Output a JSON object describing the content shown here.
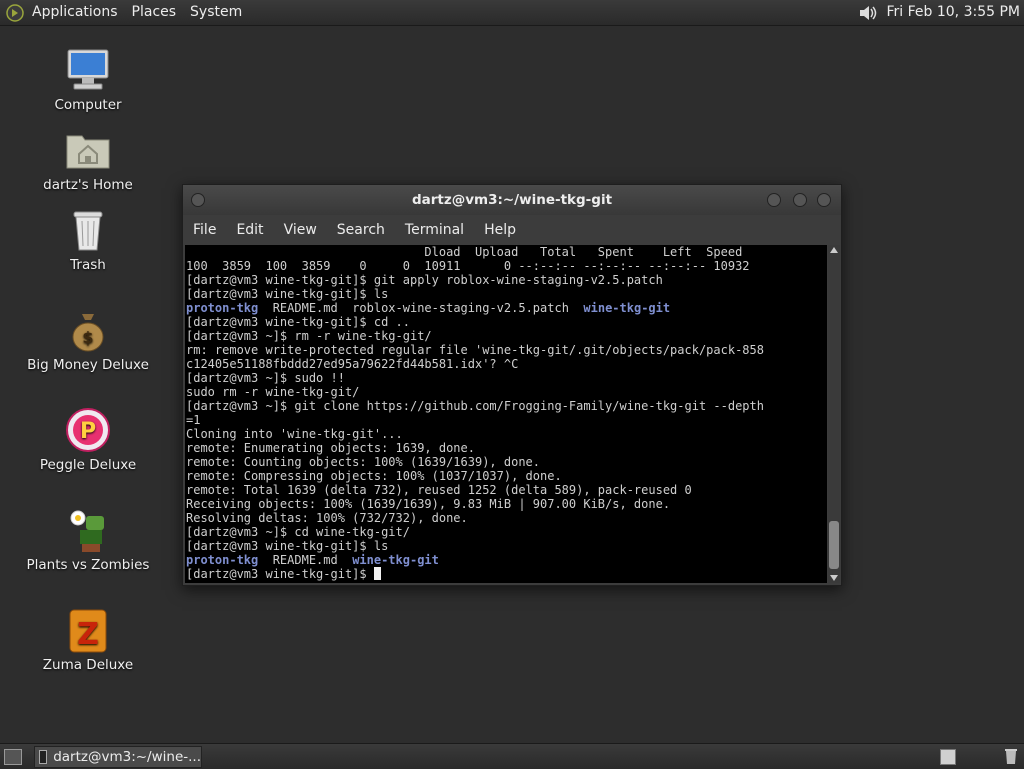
{
  "top_panel": {
    "menus": [
      "Applications",
      "Places",
      "System"
    ],
    "clock": "Fri Feb 10,  3:55 PM"
  },
  "desktop_icons": [
    {
      "label": "Computer",
      "icon": "computer-icon"
    },
    {
      "label": "dartz's Home",
      "icon": "home-folder-icon"
    },
    {
      "label": "Trash",
      "icon": "trash-icon"
    },
    {
      "label": "Big Money Deluxe",
      "icon": "money-bag-icon"
    },
    {
      "label": "Peggle Deluxe",
      "icon": "peggle-icon"
    },
    {
      "label": "Plants vs Zombies",
      "icon": "plants-vs-zombies-icon"
    },
    {
      "label": "Zuma Deluxe",
      "icon": "zuma-icon"
    }
  ],
  "terminal": {
    "title": "dartz@vm3:~/wine-tkg-git",
    "menu": [
      "File",
      "Edit",
      "View",
      "Search",
      "Terminal",
      "Help"
    ],
    "lines": [
      "                                 Dload  Upload   Total   Spent    Left  Speed",
      "100  3859  100  3859    0     0  10911      0 --:--:-- --:--:-- --:--:-- 10932",
      "[dartz@vm3 wine-tkg-git]$ git apply roblox-wine-staging-v2.5.patch",
      "[dartz@vm3 wine-tkg-git]$ ls",
      "[dartz@vm3 wine-tkg-git]$ cd ..",
      "[dartz@vm3 ~]$ rm -r wine-tkg-git/",
      "rm: remove write-protected regular file 'wine-tkg-git/.git/objects/pack/pack-858",
      "c12405e51188fbddd27ed95a79622fd44b581.idx'? ^C",
      "[dartz@vm3 ~]$ sudo !!",
      "sudo rm -r wine-tkg-git/",
      "[dartz@vm3 ~]$ git clone https://github.com/Frogging-Family/wine-tkg-git --depth",
      "=1",
      "Cloning into 'wine-tkg-git'...",
      "remote: Enumerating objects: 1639, done.",
      "remote: Counting objects: 100% (1639/1639), done.",
      "remote: Compressing objects: 100% (1037/1037), done.",
      "remote: Total 1639 (delta 732), reused 1252 (delta 589), pack-reused 0",
      "Receiving objects: 100% (1639/1639), 9.83 MiB | 907.00 KiB/s, done.",
      "Resolving deltas: 100% (732/732), done.",
      "[dartz@vm3 ~]$ cd wine-tkg-git/",
      "[dartz@vm3 wine-tkg-git]$ ls",
      "[dartz@vm3 wine-tkg-git]$ "
    ],
    "ls_output": {
      "dir1": "proton-tkg",
      "file1": "README.md",
      "file2": "roblox-wine-staging-v2.5.patch",
      "dir2": "wine-tkg-git"
    },
    "colors": {
      "background": "#000000",
      "text": "#cfcfcf",
      "directory": "#7f8fd0"
    }
  },
  "bottom_panel": {
    "task_label": "dartz@vm3:~/wine-..."
  }
}
